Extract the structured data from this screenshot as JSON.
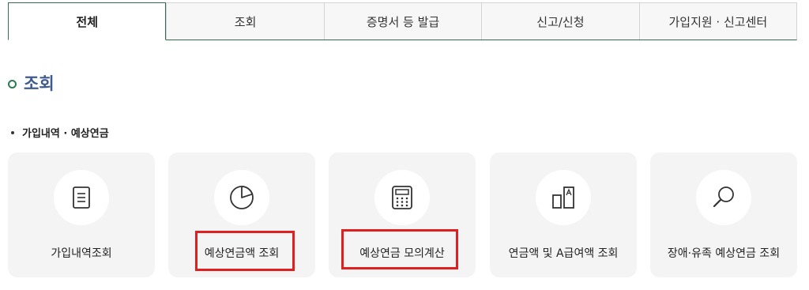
{
  "tabs": [
    {
      "label": "전체",
      "active": true
    },
    {
      "label": "조회",
      "active": false
    },
    {
      "label": "증명서 등 발급",
      "active": false
    },
    {
      "label": "신고/신청",
      "active": false
    },
    {
      "label": "가입지원 · 신고센터",
      "active": false
    }
  ],
  "section": {
    "title": "조회"
  },
  "subsection": {
    "title": "가입내역 · 예상연금"
  },
  "cards": [
    {
      "label": "가입내역조회",
      "icon": "document-icon"
    },
    {
      "label": "예상연금액 조회",
      "icon": "pie-chart-icon",
      "highlighted": true
    },
    {
      "label": "예상연금 모의계산",
      "icon": "calculator-icon",
      "highlighted": true
    },
    {
      "label": "연금액 및 A급여액 조회",
      "icon": "comparison-icon"
    },
    {
      "label": "장애·유족 예상연금 조회",
      "icon": "search-icon"
    }
  ],
  "colors": {
    "accent_green": "#2f6e4f",
    "section_title": "#3f5a8e",
    "highlight_red": "#e02020",
    "card_bg": "#f4f4f4"
  }
}
